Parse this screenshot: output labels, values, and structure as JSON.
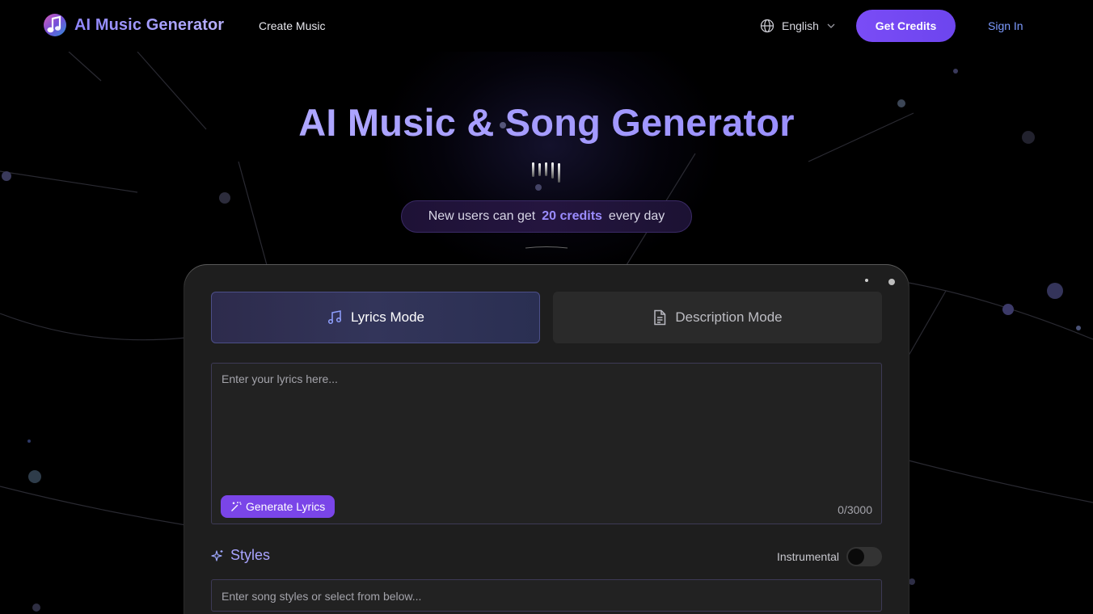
{
  "header": {
    "brand": "AI Music Generator",
    "logo_icon": "music-note-logo-icon",
    "nav_create": "Create Music",
    "language": "English",
    "language_icon": "globe-icon",
    "get_credits": "Get Credits",
    "sign_in": "Sign In"
  },
  "hero": {
    "title": "AI Music & Song Generator",
    "bars_icon": "audio-bars-icon",
    "promo": {
      "prefix": "New users can get",
      "highlight": "20 credits",
      "suffix": "every day"
    }
  },
  "generator": {
    "tabs": [
      {
        "label": "Lyrics Mode",
        "icon": "music-note-icon",
        "active": true
      },
      {
        "label": "Description Mode",
        "icon": "document-icon",
        "active": false
      }
    ],
    "lyrics": {
      "placeholder": "Enter your lyrics here...",
      "value": "",
      "generate_button": "Generate Lyrics",
      "generate_icon": "magic-wand-icon",
      "char_count": "0/3000"
    },
    "styles": {
      "label": "Styles",
      "icon": "sparkles-icon",
      "instrumental_label": "Instrumental",
      "instrumental_on": false,
      "placeholder": "Enter song styles or select from below...",
      "value": ""
    }
  },
  "colors": {
    "accent": "#7a4cf6",
    "link": "#7d9bff",
    "highlight": "#9b8cff",
    "card": "#1e1e1e"
  }
}
